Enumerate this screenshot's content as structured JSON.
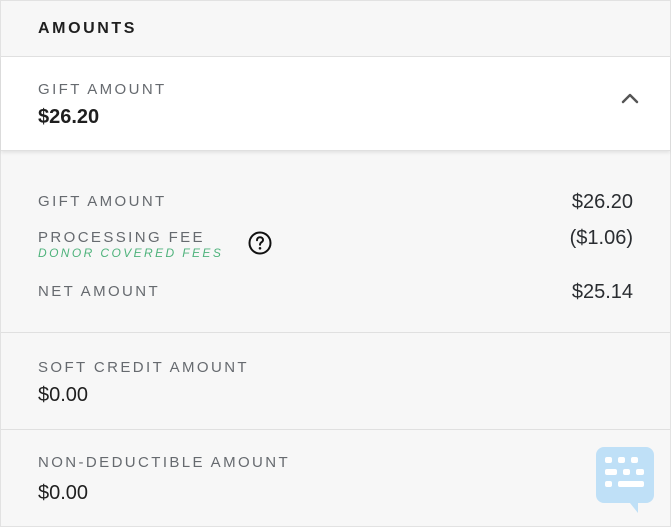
{
  "header": {
    "title": "AMOUNTS"
  },
  "summary": {
    "label": "GIFT AMOUNT",
    "value": "$26.20",
    "toggle_icon": "chevron-up-icon"
  },
  "breakdown": {
    "gift": {
      "label": "GIFT AMOUNT",
      "value": "$26.20"
    },
    "fee": {
      "label": "PROCESSING FEE",
      "note": "DONOR COVERED FEES",
      "value": "($1.06)",
      "help_icon": "question-circle-icon"
    },
    "net": {
      "label": "NET AMOUNT",
      "value": "$25.14"
    }
  },
  "soft_credit": {
    "label": "SOFT CREDIT AMOUNT",
    "value": "$0.00"
  },
  "non_deductible": {
    "label": "NON-DEDUCTIBLE AMOUNT",
    "value": "$0.00"
  },
  "chat": {
    "icon": "chat-icon",
    "color": "#bfe0f7"
  },
  "colors": {
    "accent_green": "#4fb37c",
    "label_gray": "#666a6f",
    "border": "#e0e0e0"
  }
}
